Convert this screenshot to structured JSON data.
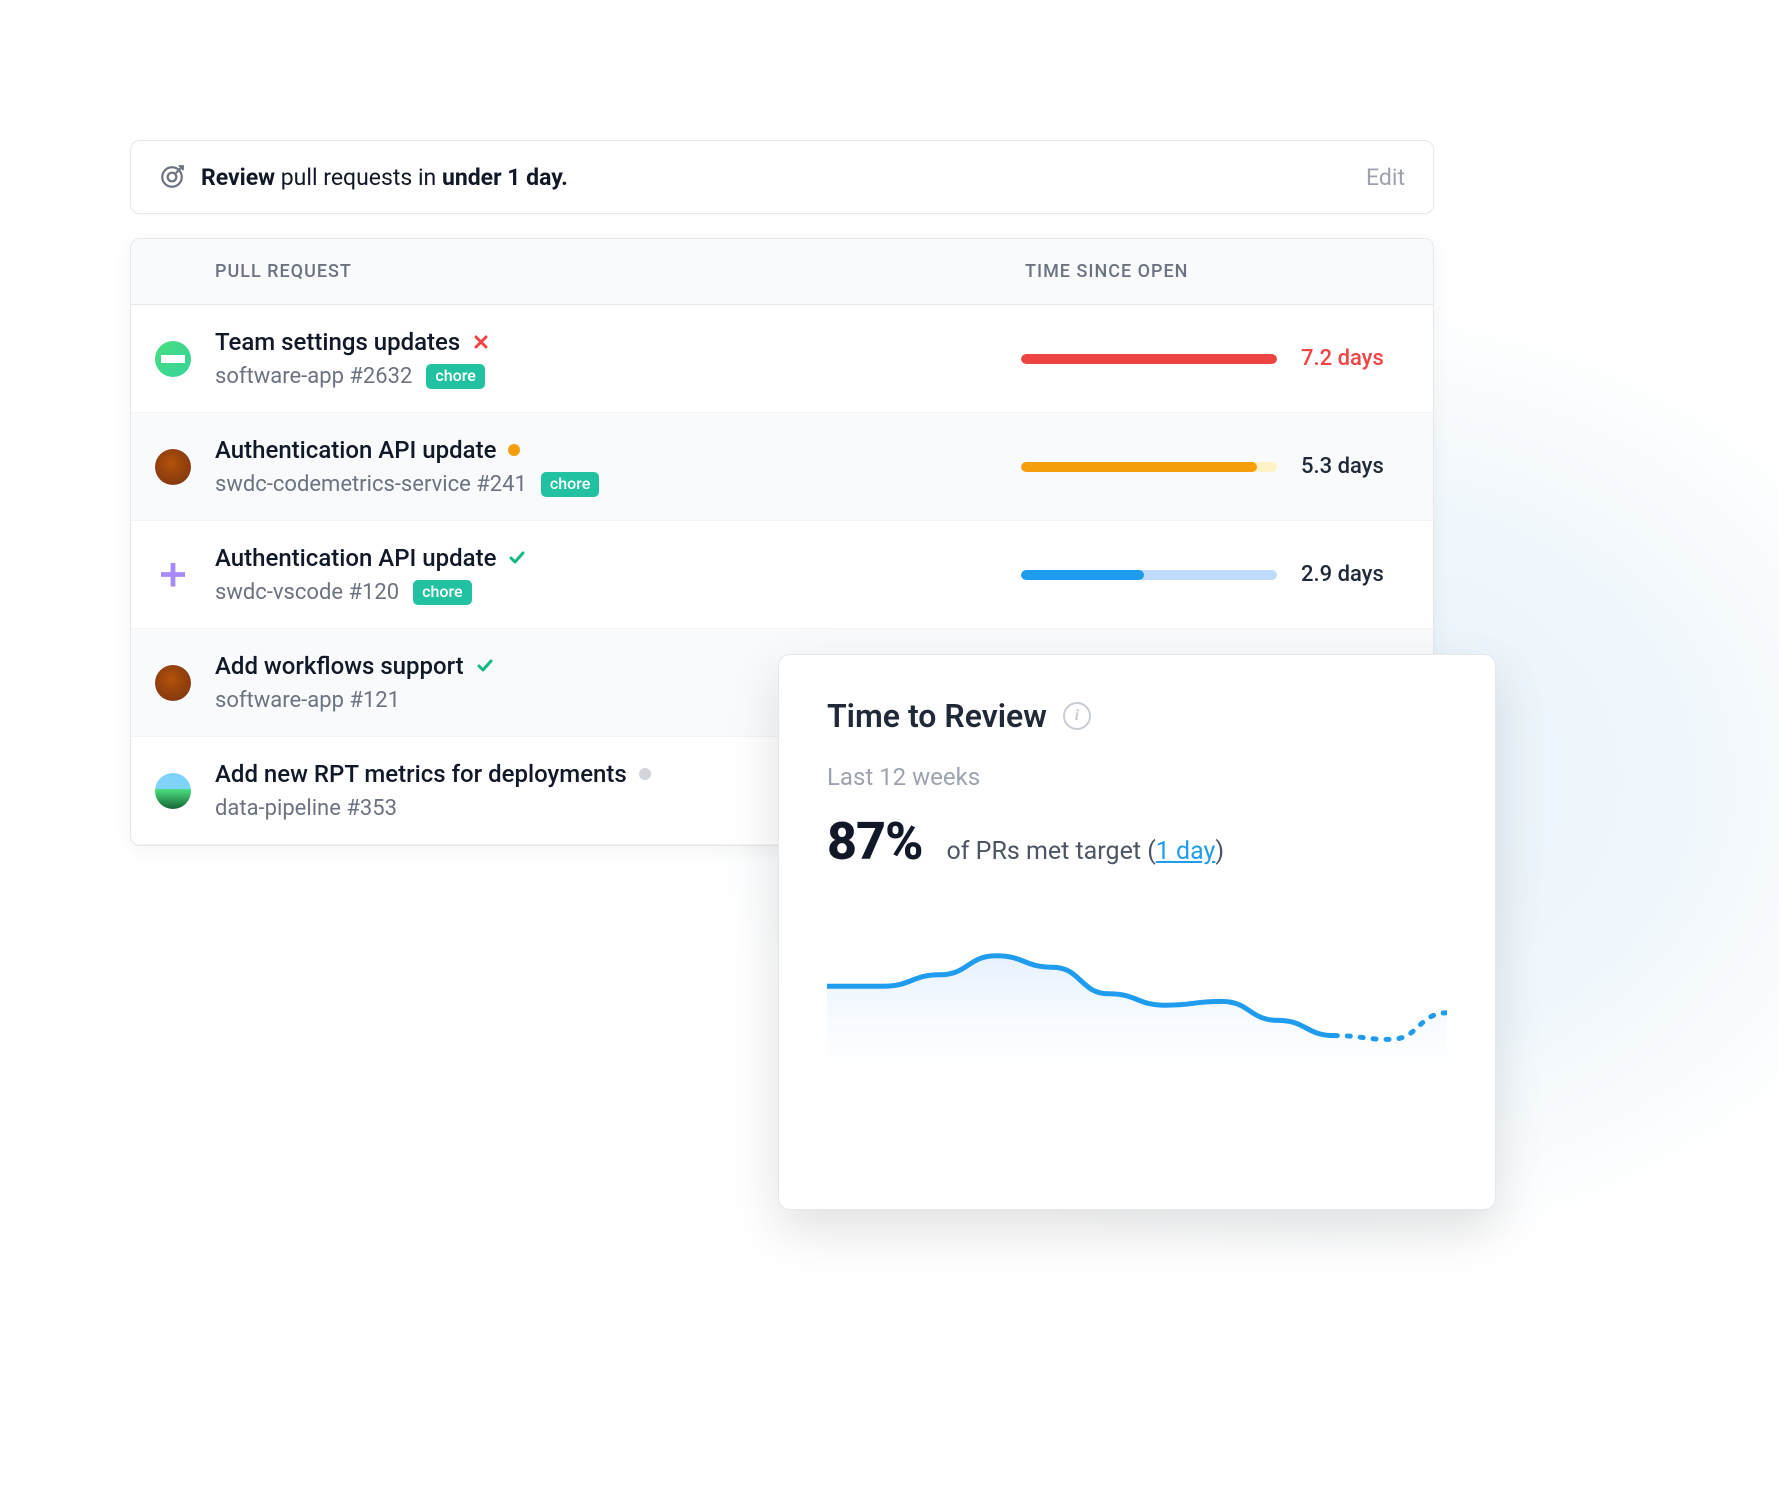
{
  "goal": {
    "prefix_bold": "Review",
    "middle": " pull requests in ",
    "suffix_bold": "under 1 day.",
    "edit_label": "Edit"
  },
  "table": {
    "col_pr_label": "PULL REQUEST",
    "col_time_label": "TIME SINCE OPEN"
  },
  "tag_label": "chore",
  "rows": [
    {
      "avatar": "teal",
      "title": "Team settings updates",
      "status": "red-x",
      "repo": "software-app #2632",
      "has_tag": true,
      "bar_color": "#ef4444",
      "bar_track": "transparent",
      "bar_pct": 100,
      "time": "7.2 days",
      "time_class": "red",
      "alt": false
    },
    {
      "avatar": "dog",
      "title": "Authentication API update",
      "status": "orange-dot",
      "repo": "swdc-codemetrics-service #241",
      "has_tag": true,
      "bar_color": "#f59e0b",
      "bar_track": "#fef3c7",
      "bar_pct": 92,
      "time": "5.3 days",
      "time_class": "dark",
      "alt": true
    },
    {
      "avatar": "purple",
      "title": "Authentication API update",
      "status": "green-check",
      "repo": "swdc-vscode #120",
      "has_tag": true,
      "bar_color": "#209cee",
      "bar_track": "#bfdbfe",
      "bar_pct": 48,
      "time": "2.9 days",
      "time_class": "dark",
      "alt": false
    },
    {
      "avatar": "dog",
      "title": "Add workflows support",
      "status": "green-check",
      "repo": "software-app #121",
      "has_tag": false,
      "bar_color": "",
      "bar_track": "",
      "bar_pct": 0,
      "time": "",
      "time_class": "",
      "alt": true
    },
    {
      "avatar": "globe",
      "title": "Add new RPT metrics for deployments",
      "status": "grey-dot",
      "repo": "data-pipeline #353",
      "has_tag": false,
      "bar_color": "",
      "bar_track": "",
      "bar_pct": 0,
      "time": "",
      "time_class": "",
      "alt": false
    }
  ],
  "review_card": {
    "title": "Time to Review",
    "period": "Last 12 weeks",
    "pct": "87%",
    "desc_prefix": "of PRs met target (",
    "link_text": "1 day",
    "desc_suffix": ")"
  },
  "chart_data": {
    "type": "line",
    "title": "Time to Review",
    "x": [
      0,
      1,
      2,
      3,
      4,
      5,
      6,
      7,
      8,
      9,
      10,
      11
    ],
    "series": [
      {
        "name": "percent_met_target",
        "values": [
          62,
          62,
          68,
          78,
          72,
          58,
          52,
          54,
          44,
          36,
          34,
          48
        ],
        "style_split_index": 9
      }
    ],
    "xlabel": "",
    "ylabel": "",
    "ylim": [
      0,
      100
    ]
  }
}
